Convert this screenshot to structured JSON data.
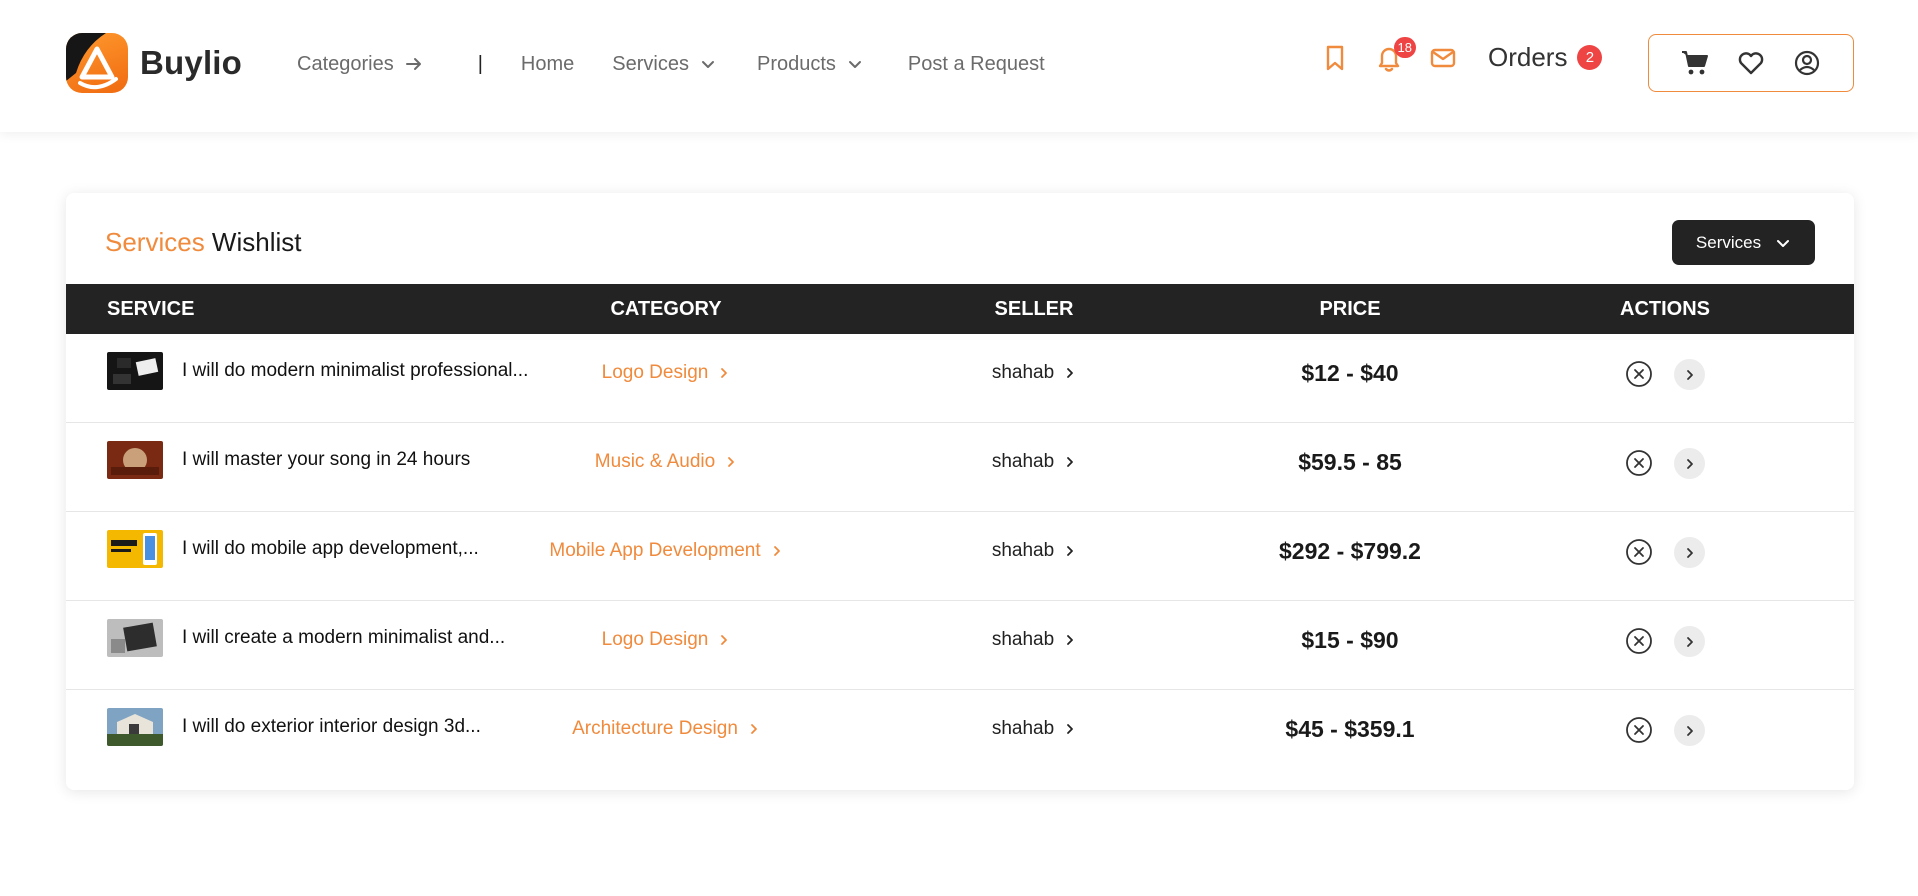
{
  "brand": {
    "name": "Buylio"
  },
  "nav": {
    "categories": "Categories",
    "separator": "|",
    "home": "Home",
    "services": "Services",
    "products": "Products",
    "post_request": "Post a Request"
  },
  "header_icons": {
    "bookmark": "bookmark-icon",
    "notifications": "bell-icon",
    "notifications_count": "18",
    "messages": "mail-icon",
    "orders_label": "Orders",
    "orders_count": "2",
    "cart": "cart-icon",
    "wishlist": "heart-icon",
    "account": "user-icon"
  },
  "colors": {
    "accent": "#f08a3c",
    "dark": "#232323",
    "badge": "#ef4444"
  },
  "wishlist": {
    "title_accent": "Services",
    "title_rest": " Wishlist",
    "filter_label": "Services",
    "columns": {
      "service": "SERVICE",
      "category": "CATEGORY",
      "seller": "SELLER",
      "price": "PRICE",
      "actions": "ACTIONS"
    },
    "rows": [
      {
        "title": "I will do modern minimalist professional...",
        "category": "Logo Design",
        "seller": "shahab",
        "price": "$12 - $40"
      },
      {
        "title": "I will master your song in 24 hours",
        "category": "Music & Audio",
        "seller": "shahab",
        "price": "$59.5 - 85"
      },
      {
        "title": "I will do mobile app development,...",
        "category": "Mobile App Development",
        "seller": "shahab",
        "price": "$292 - $799.2"
      },
      {
        "title": "I will create a modern minimalist and...",
        "category": "Logo Design",
        "seller": "shahab",
        "price": "$15 - $90"
      },
      {
        "title": "I will do exterior interior design 3d...",
        "category": "Architecture Design",
        "seller": "shahab",
        "price": "$45 - $359.1"
      }
    ]
  }
}
